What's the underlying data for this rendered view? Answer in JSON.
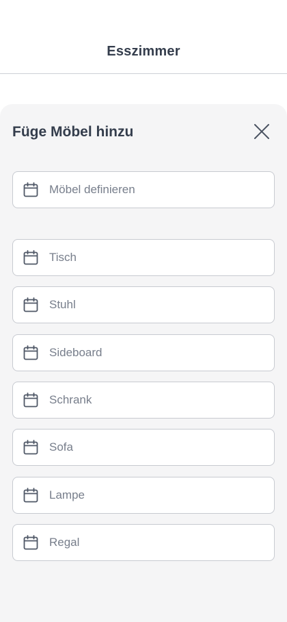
{
  "header": {
    "title": "Esszimmer"
  },
  "sheet": {
    "title": "Füge Möbel hinzu",
    "close_icon": "close-icon",
    "define_field": {
      "label": "Möbel definieren",
      "icon": "calendar-icon"
    },
    "items": [
      {
        "label": "Tisch",
        "icon": "calendar-icon"
      },
      {
        "label": "Stuhl",
        "icon": "calendar-icon"
      },
      {
        "label": "Sideboard",
        "icon": "calendar-icon"
      },
      {
        "label": "Schrank",
        "icon": "calendar-icon"
      },
      {
        "label": "Sofa",
        "icon": "calendar-icon"
      },
      {
        "label": "Lampe",
        "icon": "calendar-icon"
      },
      {
        "label": "Regal",
        "icon": "calendar-icon"
      }
    ]
  },
  "colors": {
    "text_primary": "#343d4c",
    "text_secondary": "#777e8b",
    "sheet_background": "#f5f5f6",
    "field_border": "#c7cad0"
  }
}
